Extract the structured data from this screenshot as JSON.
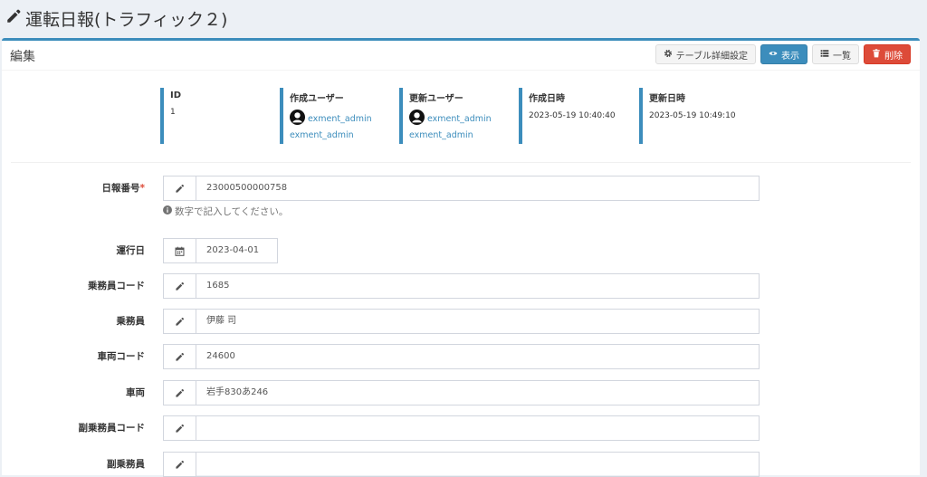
{
  "page": {
    "title": "運転日報(トラフィック２)"
  },
  "box": {
    "title": "編集",
    "buttons": {
      "table_settings": "テーブル詳細設定",
      "show": "表示",
      "list": "一覧",
      "delete": "削除"
    }
  },
  "meta": [
    {
      "label": "ID",
      "value": "1"
    },
    {
      "label": "作成ユーザー",
      "user": "exment_admin",
      "user_sub": "exment_admin"
    },
    {
      "label": "更新ユーザー",
      "user": "exment_admin",
      "user_sub": "exment_admin"
    },
    {
      "label": "作成日時",
      "value": "2023-05-19 10:40:40"
    },
    {
      "label": "更新日時",
      "value": "2023-05-19 10:49:10"
    }
  ],
  "fields": [
    {
      "label": "日報番号",
      "required_mark": "*",
      "value": "23000500000758",
      "help": "数字で記入してください。"
    },
    {
      "label": "運行日",
      "value": "2023-04-01"
    },
    {
      "label": "乗務員コード",
      "value": "1685"
    },
    {
      "label": "乗務員",
      "value": "伊藤 司"
    },
    {
      "label": "車両コード",
      "value": "24600"
    },
    {
      "label": "車両",
      "value": "岩手830あ246"
    },
    {
      "label": "副乗務員コード",
      "value": ""
    },
    {
      "label": "副乗務員",
      "value": ""
    }
  ],
  "colors": {
    "primary": "#3c8dbc",
    "danger": "#dd4b39",
    "background": "#ecf0f5"
  }
}
